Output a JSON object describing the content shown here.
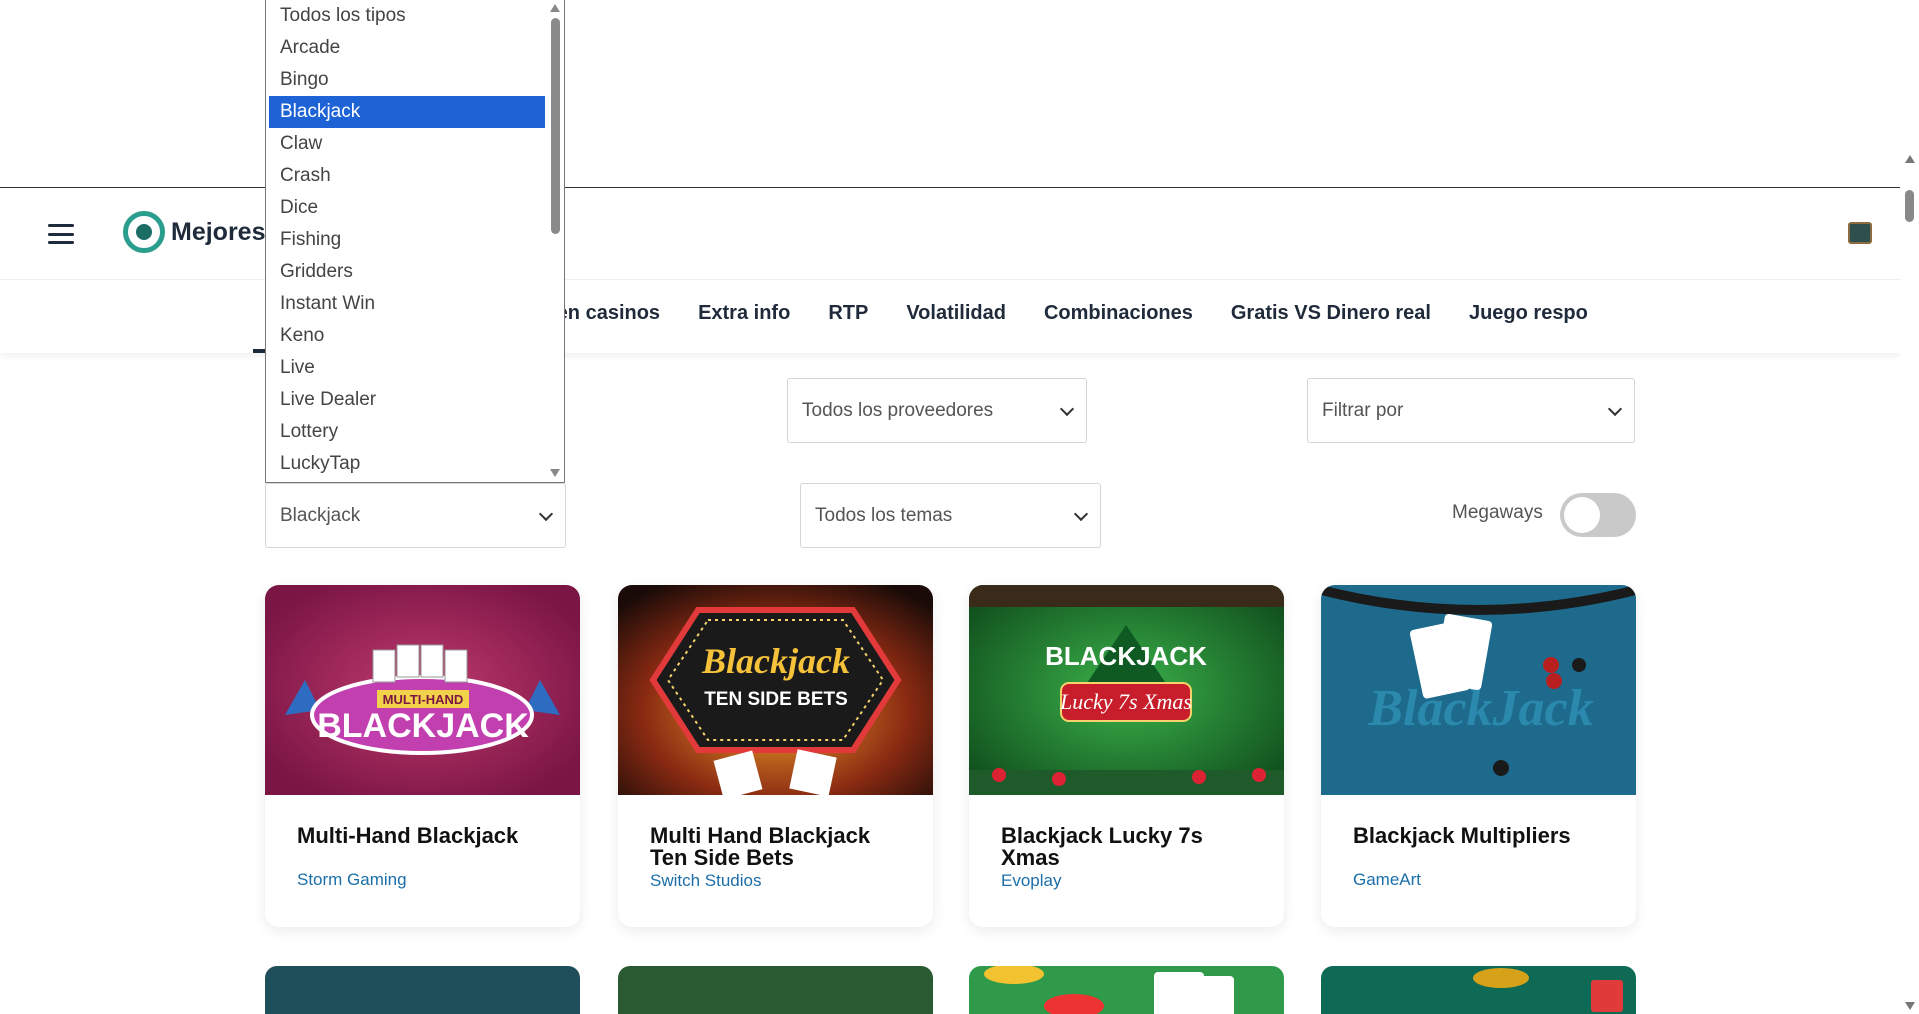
{
  "header": {
    "logo_text": "Mejores("
  },
  "nav": {
    "items": [
      "s en casinos",
      "Extra info",
      "RTP",
      "Volatilidad",
      "Combinaciones",
      "Gratis VS Dinero real",
      "Juego respo"
    ]
  },
  "filters": {
    "type_selected": "Blackjack",
    "providers": "Todos los proveedores",
    "themes": "Todos los temas",
    "sort": "Filtrar por",
    "megaways_label": "Megaways",
    "megaways_on": false
  },
  "dropdown": {
    "options": [
      "Todos los tipos",
      "Arcade",
      "Bingo",
      "Blackjack",
      "Claw",
      "Crash",
      "Dice",
      "Fishing",
      "Gridders",
      "Instant Win",
      "Keno",
      "Live",
      "Live Dealer",
      "Lottery",
      "LuckyTap"
    ],
    "selected": "Blackjack"
  },
  "games": [
    {
      "title": "Multi-Hand Blackjack",
      "provider": "Storm Gaming",
      "image_text": "MULTI-HAND BLACKJACK"
    },
    {
      "title": "Multi Hand Blackjack Ten Side Bets",
      "provider": "Switch Studios",
      "image_text": "Blackjack TEN SIDE BETS"
    },
    {
      "title": "Blackjack Lucky 7s Xmas",
      "provider": "Evoplay",
      "image_text": "BLACKJACK Lucky 7s Xmas"
    },
    {
      "title": "Blackjack Multipliers",
      "provider": "GameArt",
      "image_text": "BlackJack"
    }
  ],
  "colors": {
    "selected_option": "#1e63d6",
    "provider_link": "#1b6ea8",
    "nav_text": "#1f2a3a"
  }
}
